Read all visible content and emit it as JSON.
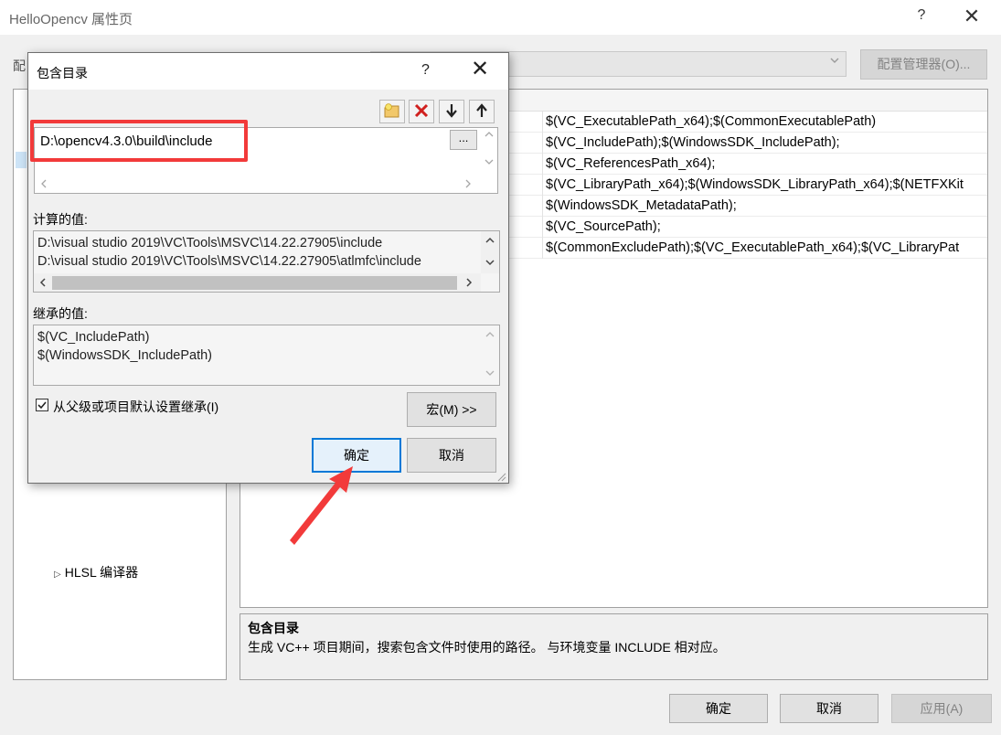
{
  "outer_window": {
    "title": "HelloOpencv 属性页",
    "help": "?",
    "close": "✕",
    "config_label": "配",
    "config_manager": "配置管理器(O)...",
    "tree_item": "HLSL 编译器",
    "grid_rows": [
      "$(VC_ExecutablePath_x64);$(CommonExecutablePath)",
      "$(VC_IncludePath);$(WindowsSDK_IncludePath);",
      "$(VC_ReferencesPath_x64);",
      "$(VC_LibraryPath_x64);$(WindowsSDK_LibraryPath_x64);$(NETFXKit",
      "$(WindowsSDK_MetadataPath);",
      "$(VC_SourcePath);",
      "$(CommonExcludePath);$(VC_ExecutablePath_x64);$(VC_LibraryPat"
    ],
    "description_title": "包含目录",
    "description_text": "生成 VC++ 项目期间，搜索包含文件时使用的路径。 与环境变量 INCLUDE 相对应。",
    "ok": "确定",
    "cancel": "取消",
    "apply": "应用(A)"
  },
  "dialog": {
    "title": "包含目录",
    "help": "?",
    "close": "✕",
    "toolbar": {
      "new_line_icon": "folder-star-icon",
      "delete_icon": "red-x-icon",
      "move_down_icon": "arrow-down-icon",
      "move_up_icon": "arrow-up-icon"
    },
    "edit_value": "D:\\opencv4.3.0\\build\\include",
    "ellipsis": "...",
    "computed_label": "计算的值:",
    "computed_values": [
      "D:\\visual studio 2019\\VC\\Tools\\MSVC\\14.22.27905\\include",
      "D:\\visual studio 2019\\VC\\Tools\\MSVC\\14.22.27905\\atlmfc\\include"
    ],
    "inherited_label": "继承的值:",
    "inherited_values": [
      "$(VC_IncludePath)",
      "$(WindowsSDK_IncludePath)"
    ],
    "inherit_checkbox_label": "从父级或项目默认设置继承(I)",
    "inherit_checked": true,
    "macro_button": "宏(M) >>",
    "ok": "确定",
    "cancel": "取消"
  },
  "annotation_color": "#f23a3a",
  "focus_color": "#0078d7"
}
